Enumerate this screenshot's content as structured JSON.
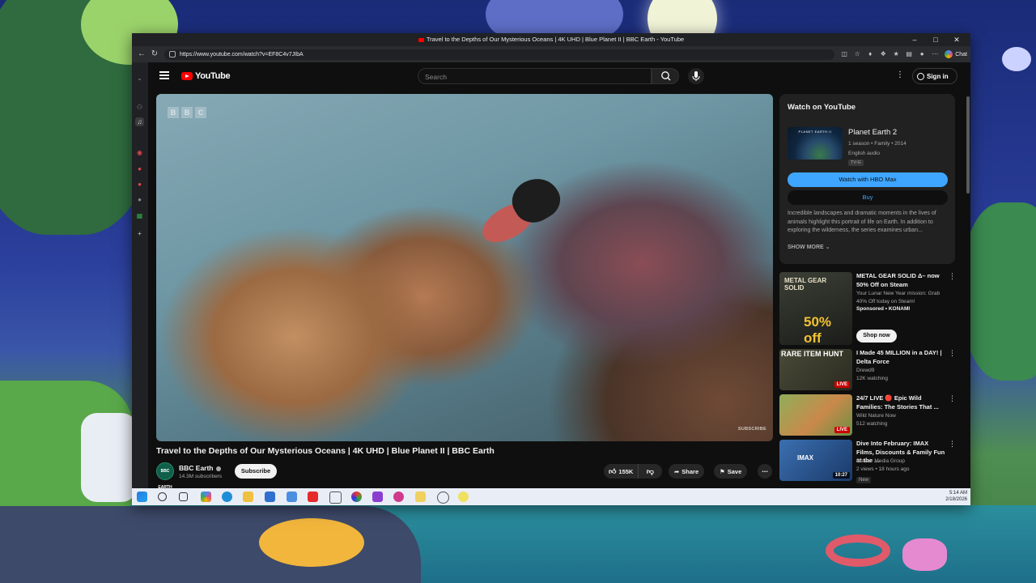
{
  "window": {
    "tab_title": "Travel to the Depths of Our Mysterious Oceans | 4K UHD | Blue Planet II | BBC Earth - YouTube",
    "url": "https://www.youtube.com/watch?v=EF8C4v7JIbA",
    "chat_label": "Chat"
  },
  "youtube": {
    "logo_text": "YouTube",
    "search_placeholder": "Search",
    "sign_in_label": "Sign in",
    "video": {
      "watermark": [
        "B",
        "B",
        "C"
      ],
      "subscribe_watermark": "SUBSCRIBE",
      "title": "Travel to the Depths of Our Mysterious Oceans | 4K UHD | Blue Planet II | BBC Earth",
      "channel_name": "BBC Earth",
      "channel_avatar_text": "BBC EARTH",
      "subscribers": "14.3M subscribers",
      "subscribe_label": "Subscribe",
      "likes": "155K",
      "share_label": "Share",
      "save_label": "Save"
    },
    "watch_card": {
      "heading": "Watch on YouTube",
      "poster_text": "PLANET EARTH II",
      "title": "Planet Earth 2",
      "meta": "1 season • Family • 2014",
      "audio": "English audio",
      "rating": "TV-G",
      "primary_button": "Watch with HBO Max",
      "secondary_button": "Buy",
      "description": "Incredible landscapes and dramatic moments in the lives of animals highlight this portrait of life on Earth. In addition to exploring the wilderness, the series examines urban...",
      "show_more": "SHOW MORE"
    },
    "recommendations": [
      {
        "title": "METAL GEAR SOLID Δ– now 50% Off on Steam",
        "line1": "Your Lunar New Year mission: Grab 40% Off today on Steam!",
        "line2": "Sponsored • KONAMI",
        "button": "Shop now",
        "thumb_text": "METAL GEAR SOLID",
        "thumb_badge": "50% off"
      },
      {
        "title": "I Made 45 MILLION in a DAY! | Delta Force",
        "line1": "Drewd9",
        "line2": "12K watching",
        "badge": "LIVE",
        "thumb_text": "RARE ITEM HUNT"
      },
      {
        "title": "24/7 LIVE 🔴 Epic Wild Families: The Stories That ...",
        "line1": "Wild Nature Now",
        "line2": "512 watching",
        "badge": "LIVE"
      },
      {
        "title": "Dive Into February: IMAX Films, Discounts & Family Fun at the ...",
        "line1": "Brewer Media Group",
        "line2": "2 views • 18 hours ago",
        "tag": "New",
        "duration": "10:27",
        "thumb_text": "IMAX"
      }
    ]
  },
  "taskbar": {
    "time": "5:14 AM",
    "date": "2/18/2026"
  }
}
